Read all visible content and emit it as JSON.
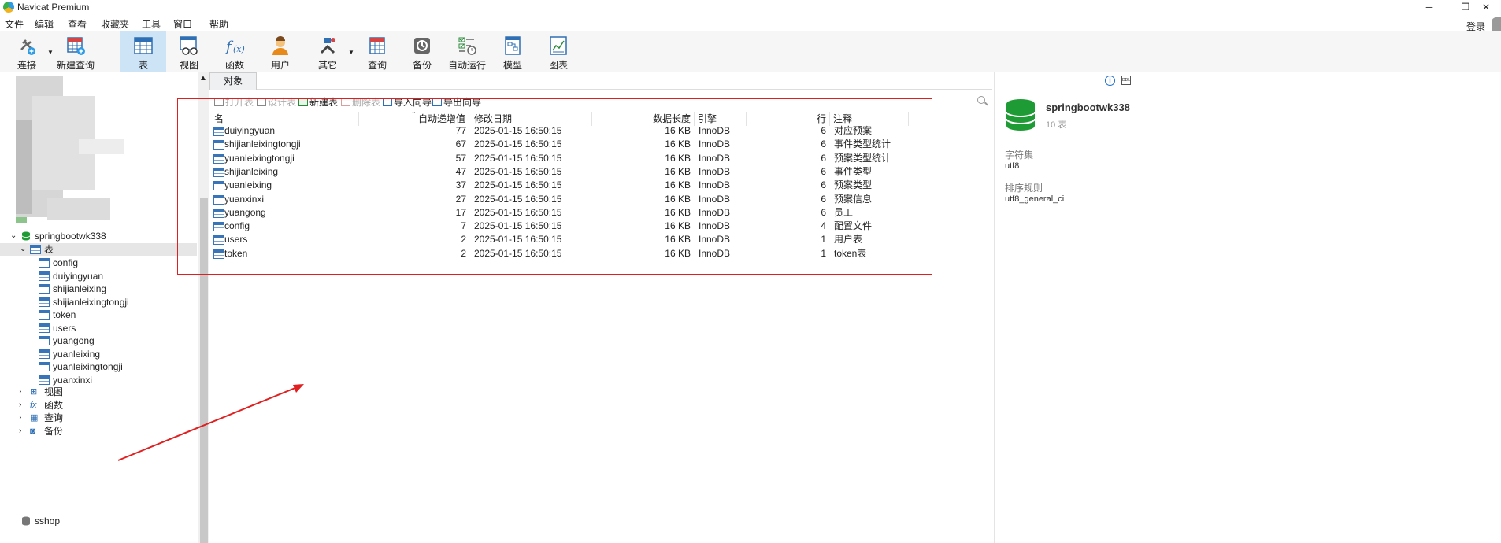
{
  "window": {
    "title": "Navicat Premium",
    "controls": [
      "─",
      "❐",
      "✕"
    ]
  },
  "menu": [
    "文件",
    "编辑",
    "查看",
    "收藏夹",
    "工具",
    "窗口",
    "帮助"
  ],
  "login_label": "登录",
  "toolbar": [
    {
      "label": "连接",
      "icon": "connection-plug-icon"
    },
    {
      "label": "新建查询",
      "icon": "new-query-icon"
    },
    {
      "label": "表",
      "icon": "table-icon",
      "active": true
    },
    {
      "label": "视图",
      "icon": "view-icon"
    },
    {
      "label": "函数",
      "icon": "function-icon"
    },
    {
      "label": "用户",
      "icon": "user-icon"
    },
    {
      "label": "其它",
      "icon": "tools-icon"
    },
    {
      "label": "查询",
      "icon": "query-icon"
    },
    {
      "label": "备份",
      "icon": "backup-icon"
    },
    {
      "label": "自动运行",
      "icon": "automation-icon"
    },
    {
      "label": "模型",
      "icon": "model-icon"
    },
    {
      "label": "图表",
      "icon": "chart-icon"
    }
  ],
  "tree": {
    "database": "springbootwk338",
    "tables_node": "表",
    "tables": [
      "config",
      "duiyingyuan",
      "shijianleixing",
      "shijianleixingtongji",
      "token",
      "users",
      "yuangong",
      "yuanleixing",
      "yuanleixingtongji",
      "yuanxinxi"
    ],
    "other_nodes": [
      {
        "label": "视图",
        "icon": "view-icon"
      },
      {
        "label": "函数",
        "icon": "function-icon"
      },
      {
        "label": "查询",
        "icon": "query-icon"
      },
      {
        "label": "备份",
        "icon": "backup-icon"
      }
    ],
    "next_database": "sshop"
  },
  "object_tab": "对象",
  "object_toolbar": [
    {
      "label": "打开表",
      "enabled": false
    },
    {
      "label": "设计表",
      "enabled": false
    },
    {
      "label": "新建表",
      "enabled": true
    },
    {
      "label": "删除表",
      "enabled": false
    },
    {
      "label": "导入向导",
      "enabled": true
    },
    {
      "label": "导出向导",
      "enabled": true
    }
  ],
  "table_headers": {
    "name": "名",
    "auto_inc": "自动递增值",
    "modified": "修改日期",
    "data_len": "数据长度",
    "engine": "引擎",
    "rows": "行",
    "comment": "注释"
  },
  "table_rows": [
    {
      "name": "duiyingyuan",
      "auto_inc": "77",
      "modified": "2025-01-15 16:50:15",
      "data_len": "16 KB",
      "engine": "InnoDB",
      "rows": "6",
      "comment": "对应预案"
    },
    {
      "name": "shijianleixingtongji",
      "auto_inc": "67",
      "modified": "2025-01-15 16:50:15",
      "data_len": "16 KB",
      "engine": "InnoDB",
      "rows": "6",
      "comment": "事件类型统计"
    },
    {
      "name": "yuanleixingtongji",
      "auto_inc": "57",
      "modified": "2025-01-15 16:50:15",
      "data_len": "16 KB",
      "engine": "InnoDB",
      "rows": "6",
      "comment": "预案类型统计"
    },
    {
      "name": "shijianleixing",
      "auto_inc": "47",
      "modified": "2025-01-15 16:50:15",
      "data_len": "16 KB",
      "engine": "InnoDB",
      "rows": "6",
      "comment": "事件类型"
    },
    {
      "name": "yuanleixing",
      "auto_inc": "37",
      "modified": "2025-01-15 16:50:15",
      "data_len": "16 KB",
      "engine": "InnoDB",
      "rows": "6",
      "comment": "预案类型"
    },
    {
      "name": "yuanxinxi",
      "auto_inc": "27",
      "modified": "2025-01-15 16:50:15",
      "data_len": "16 KB",
      "engine": "InnoDB",
      "rows": "6",
      "comment": "预案信息"
    },
    {
      "name": "yuangong",
      "auto_inc": "17",
      "modified": "2025-01-15 16:50:15",
      "data_len": "16 KB",
      "engine": "InnoDB",
      "rows": "6",
      "comment": "员工"
    },
    {
      "name": "config",
      "auto_inc": "7",
      "modified": "2025-01-15 16:50:15",
      "data_len": "16 KB",
      "engine": "InnoDB",
      "rows": "4",
      "comment": "配置文件"
    },
    {
      "name": "users",
      "auto_inc": "2",
      "modified": "2025-01-15 16:50:15",
      "data_len": "16 KB",
      "engine": "InnoDB",
      "rows": "1",
      "comment": "用户表"
    },
    {
      "name": "token",
      "auto_inc": "2",
      "modified": "2025-01-15 16:50:15",
      "data_len": "16 KB",
      "engine": "InnoDB",
      "rows": "1",
      "comment": "token表"
    }
  ],
  "info_panel": {
    "db_name": "springbootwk338",
    "table_count": "10 表",
    "charset_label": "字符集",
    "charset_value": "utf8",
    "collation_label": "排序规则",
    "collation_value": "utf8_general_ci"
  },
  "colors": {
    "accent": "#1e6fd0",
    "annotation_red": "#e02020",
    "db_green": "#1e9b34",
    "active_tool": "#cde4f7"
  }
}
